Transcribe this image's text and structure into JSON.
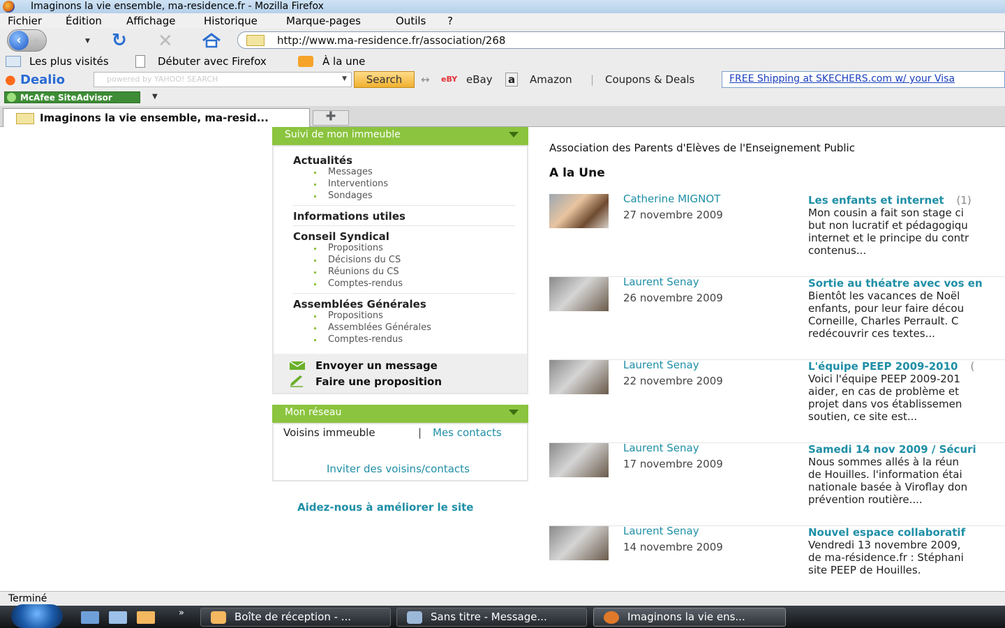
{
  "window": {
    "title": "Imaginons la vie ensemble, ma-residence.fr - Mozilla Firefox"
  },
  "menu": [
    "Fichier",
    "Édition",
    "Affichage",
    "Historique",
    "Marque-pages",
    "Outils",
    "?"
  ],
  "address": {
    "url": "http://www.ma-residence.fr/association/268"
  },
  "bookmarks": [
    "Les plus visités",
    "Débuter avec Firefox",
    "À la une"
  ],
  "dealio": {
    "brand": "Dealio",
    "search_placeholder": "powered by YAHOO! SEARCH",
    "search_button": "Search",
    "ebay": "eBay",
    "amazon": "Amazon",
    "coupons": "Coupons & Deals",
    "promo": "FREE Shipping at SKECHERS.com w/ your Visa"
  },
  "mcafee": {
    "label": "McAfee SiteAdvisor"
  },
  "tab": {
    "title": "Imaginons la vie ensemble, ma-resid..."
  },
  "sidebar": {
    "panel1_title": "Suivi de mon immeuble",
    "sections": [
      {
        "title": "Actualités",
        "items": [
          "Messages",
          "Interventions",
          "Sondages"
        ]
      },
      {
        "title": "Informations utiles",
        "items": []
      },
      {
        "title": "Conseil Syndical",
        "items": [
          "Propositions",
          "Décisions du CS",
          "Réunions du CS",
          "Comptes-rendus"
        ]
      },
      {
        "title": "Assemblées Générales",
        "items": [
          "Propositions",
          "Assemblées Générales",
          "Comptes-rendus"
        ]
      }
    ],
    "actions": {
      "send_message": "Envoyer un message",
      "make_proposal": "Faire une proposition"
    },
    "panel2_title": "Mon réseau",
    "network": {
      "neighbors": "Voisins immeuble",
      "separator": "|",
      "contacts": "Mes contacts",
      "invite": "Inviter des voisins/contacts"
    },
    "help_link": "Aidez-nous à améliorer le site"
  },
  "main": {
    "association": "Association des Parents d'Elèves de l'Enseignement Public",
    "heading": "A la Une",
    "posts": [
      {
        "author": "Catherine MIGNOT",
        "date": "27 novembre 2009",
        "title": "Les enfants et internet",
        "count": "(1)",
        "body": "Mon cousin a fait son stage ci\nbut non lucratif et pédagogiqu\ninternet et le principe du contr\ncontenus..."
      },
      {
        "author": "Laurent Senay",
        "date": "26 novembre 2009",
        "title": "Sortie au théatre avec vos en",
        "count": "",
        "body": "Bientôt les vacances de Noël\nenfants, pour leur faire décou\nCorneille, Charles Perrault. C\nredécouvrir ces textes..."
      },
      {
        "author": "Laurent Senay",
        "date": "22 novembre 2009",
        "title": "L'équipe PEEP 2009-2010",
        "count": "(",
        "body": "Voici l'équipe PEEP 2009-201\naider, en cas de problème et\nprojet dans vos établissemen\nsoutien, ce site est..."
      },
      {
        "author": "Laurent Senay",
        "date": "17 novembre 2009",
        "title": "Samedi 14 nov 2009 / Sécuri",
        "count": "",
        "body": "Nous sommes allés à la réun\nde Houilles. l'information étai\nnationale basée à Viroflay don\nprévention routière...."
      },
      {
        "author": "Laurent Senay",
        "date": "14 novembre 2009",
        "title": "Nouvel espace collaboratif",
        "count": "",
        "body": "Vendredi 13 novembre 2009,\nde ma-résidence.fr : Stéphani\nsite PEEP de Houilles."
      }
    ]
  },
  "status": {
    "text": "Terminé"
  },
  "taskbar": {
    "items": [
      "Boîte de réception - ...",
      "Sans titre - Message...",
      "Imaginons la vie ens..."
    ],
    "overflow": "»"
  },
  "colors": {
    "accent_green": "#8bc43e",
    "link_teal": "#1f8fa6"
  }
}
